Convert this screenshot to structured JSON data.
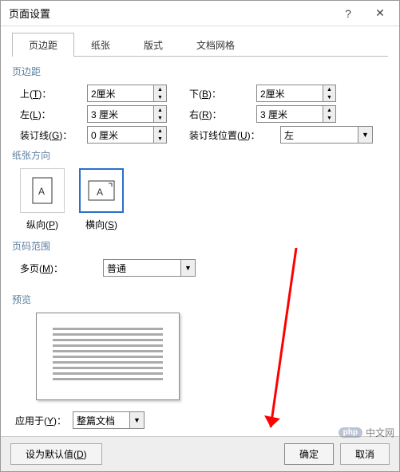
{
  "window": {
    "title": "页面设置"
  },
  "tabs": [
    "页边距",
    "纸张",
    "版式",
    "文档网格"
  ],
  "margins": {
    "group": "页边距",
    "top_label": "上(T)：",
    "top": "2厘米",
    "bottom_label": "下(B)：",
    "bottom": "2厘米",
    "left_label": "左(L)：",
    "left": "3 厘米",
    "right_label": "右(R)：",
    "right": "3 厘米",
    "gutter_label": "装订线(G)：",
    "gutter": "0 厘米",
    "gutter_pos_label": "装订线位置(U)：",
    "gutter_pos": "左"
  },
  "orientation": {
    "group": "纸张方向",
    "portrait": "纵向(P)",
    "landscape": "横向(S)",
    "selected": "landscape"
  },
  "pages": {
    "group": "页码范围",
    "multi_label": "多页(M)：",
    "multi": "普通"
  },
  "preview": {
    "group": "预览"
  },
  "apply": {
    "label": "应用于(Y)：",
    "value": "整篇文档"
  },
  "footer": {
    "defaults": "设为默认值(D)",
    "ok": "确定",
    "cancel": "取消"
  },
  "watermark": {
    "brand": "php",
    "text": "中文网"
  }
}
